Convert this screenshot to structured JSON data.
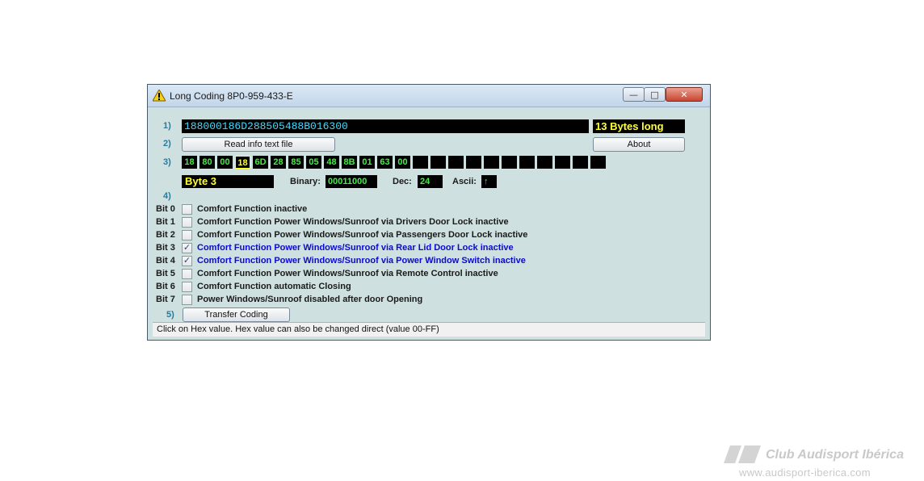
{
  "window": {
    "title": "Long Coding 8P0-959-433-E",
    "icon": "warning-icon",
    "controls": {
      "minimize": "—",
      "maximize": "□",
      "close": "✕"
    }
  },
  "row1": {
    "number": "1)",
    "coding": "188000186D288505488B016300",
    "bytes_long": "13 Bytes long"
  },
  "row2": {
    "number": "2)",
    "read_button": "Read info text file",
    "about_button": "About"
  },
  "row3": {
    "number": "3)",
    "bytes": [
      "18",
      "80",
      "00",
      "18",
      "6D",
      "28",
      "85",
      "05",
      "48",
      "8B",
      "01",
      "63",
      "00",
      "",
      "",
      "",
      "",
      "",
      "",
      "",
      "",
      "",
      "",
      ""
    ],
    "selected_index": 3
  },
  "byte_info": {
    "byte_label": "Byte 3",
    "binary_label": "Binary:",
    "binary_value": "00011000",
    "dec_label": "Dec:",
    "dec_value": "24",
    "ascii_label": "Ascii:",
    "ascii_value": "↑"
  },
  "row4": {
    "number": "4)"
  },
  "bits": [
    {
      "label": "Bit 0",
      "checked": false,
      "text": "Comfort Function inactive"
    },
    {
      "label": "Bit 1",
      "checked": false,
      "text": "Comfort Function Power Windows/Sunroof via Drivers Door Lock inactive"
    },
    {
      "label": "Bit 2",
      "checked": false,
      "text": "Comfort Function Power Windows/Sunroof via Passengers Door Lock inactive"
    },
    {
      "label": "Bit 3",
      "checked": true,
      "text": "Comfort Function Power Windows/Sunroof via Rear Lid Door Lock inactive"
    },
    {
      "label": "Bit 4",
      "checked": true,
      "text": "Comfort Function Power Windows/Sunroof via Power Window Switch inactive"
    },
    {
      "label": "Bit 5",
      "checked": false,
      "text": "Comfort Function Power Windows/Sunroof via Remote Control inactive"
    },
    {
      "label": "Bit 6",
      "checked": false,
      "text": "Comfort Function automatic Closing"
    },
    {
      "label": "Bit 7",
      "checked": false,
      "text": "Power Windows/Sunroof disabled after door Opening"
    }
  ],
  "row5": {
    "number": "5)",
    "transfer_button": "Transfer Coding"
  },
  "status": "Click on Hex value. Hex value can also be changed direct (value 00-FF)",
  "watermark": {
    "brand": "Club Audisport Ibérica",
    "url": "www.audisport-iberica.com"
  },
  "colors": {
    "window_bg": "#cfe0e0",
    "coding_text": "#3bdcff",
    "highlight_yellow": "#ffff33",
    "hex_green": "#3ff33f",
    "checked_text": "#0a0ad0"
  }
}
